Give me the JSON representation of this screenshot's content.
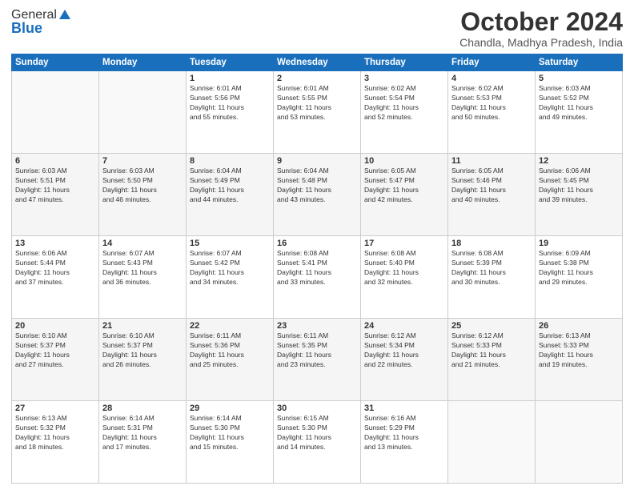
{
  "header": {
    "logo_general": "General",
    "logo_blue": "Blue",
    "title": "October 2024",
    "subtitle": "Chandla, Madhya Pradesh, India"
  },
  "weekdays": [
    "Sunday",
    "Monday",
    "Tuesday",
    "Wednesday",
    "Thursday",
    "Friday",
    "Saturday"
  ],
  "weeks": [
    [
      {
        "day": "",
        "info": ""
      },
      {
        "day": "",
        "info": ""
      },
      {
        "day": "1",
        "info": "Sunrise: 6:01 AM\nSunset: 5:56 PM\nDaylight: 11 hours\nand 55 minutes."
      },
      {
        "day": "2",
        "info": "Sunrise: 6:01 AM\nSunset: 5:55 PM\nDaylight: 11 hours\nand 53 minutes."
      },
      {
        "day": "3",
        "info": "Sunrise: 6:02 AM\nSunset: 5:54 PM\nDaylight: 11 hours\nand 52 minutes."
      },
      {
        "day": "4",
        "info": "Sunrise: 6:02 AM\nSunset: 5:53 PM\nDaylight: 11 hours\nand 50 minutes."
      },
      {
        "day": "5",
        "info": "Sunrise: 6:03 AM\nSunset: 5:52 PM\nDaylight: 11 hours\nand 49 minutes."
      }
    ],
    [
      {
        "day": "6",
        "info": "Sunrise: 6:03 AM\nSunset: 5:51 PM\nDaylight: 11 hours\nand 47 minutes."
      },
      {
        "day": "7",
        "info": "Sunrise: 6:03 AM\nSunset: 5:50 PM\nDaylight: 11 hours\nand 46 minutes."
      },
      {
        "day": "8",
        "info": "Sunrise: 6:04 AM\nSunset: 5:49 PM\nDaylight: 11 hours\nand 44 minutes."
      },
      {
        "day": "9",
        "info": "Sunrise: 6:04 AM\nSunset: 5:48 PM\nDaylight: 11 hours\nand 43 minutes."
      },
      {
        "day": "10",
        "info": "Sunrise: 6:05 AM\nSunset: 5:47 PM\nDaylight: 11 hours\nand 42 minutes."
      },
      {
        "day": "11",
        "info": "Sunrise: 6:05 AM\nSunset: 5:46 PM\nDaylight: 11 hours\nand 40 minutes."
      },
      {
        "day": "12",
        "info": "Sunrise: 6:06 AM\nSunset: 5:45 PM\nDaylight: 11 hours\nand 39 minutes."
      }
    ],
    [
      {
        "day": "13",
        "info": "Sunrise: 6:06 AM\nSunset: 5:44 PM\nDaylight: 11 hours\nand 37 minutes."
      },
      {
        "day": "14",
        "info": "Sunrise: 6:07 AM\nSunset: 5:43 PM\nDaylight: 11 hours\nand 36 minutes."
      },
      {
        "day": "15",
        "info": "Sunrise: 6:07 AM\nSunset: 5:42 PM\nDaylight: 11 hours\nand 34 minutes."
      },
      {
        "day": "16",
        "info": "Sunrise: 6:08 AM\nSunset: 5:41 PM\nDaylight: 11 hours\nand 33 minutes."
      },
      {
        "day": "17",
        "info": "Sunrise: 6:08 AM\nSunset: 5:40 PM\nDaylight: 11 hours\nand 32 minutes."
      },
      {
        "day": "18",
        "info": "Sunrise: 6:08 AM\nSunset: 5:39 PM\nDaylight: 11 hours\nand 30 minutes."
      },
      {
        "day": "19",
        "info": "Sunrise: 6:09 AM\nSunset: 5:38 PM\nDaylight: 11 hours\nand 29 minutes."
      }
    ],
    [
      {
        "day": "20",
        "info": "Sunrise: 6:10 AM\nSunset: 5:37 PM\nDaylight: 11 hours\nand 27 minutes."
      },
      {
        "day": "21",
        "info": "Sunrise: 6:10 AM\nSunset: 5:37 PM\nDaylight: 11 hours\nand 26 minutes."
      },
      {
        "day": "22",
        "info": "Sunrise: 6:11 AM\nSunset: 5:36 PM\nDaylight: 11 hours\nand 25 minutes."
      },
      {
        "day": "23",
        "info": "Sunrise: 6:11 AM\nSunset: 5:35 PM\nDaylight: 11 hours\nand 23 minutes."
      },
      {
        "day": "24",
        "info": "Sunrise: 6:12 AM\nSunset: 5:34 PM\nDaylight: 11 hours\nand 22 minutes."
      },
      {
        "day": "25",
        "info": "Sunrise: 6:12 AM\nSunset: 5:33 PM\nDaylight: 11 hours\nand 21 minutes."
      },
      {
        "day": "26",
        "info": "Sunrise: 6:13 AM\nSunset: 5:33 PM\nDaylight: 11 hours\nand 19 minutes."
      }
    ],
    [
      {
        "day": "27",
        "info": "Sunrise: 6:13 AM\nSunset: 5:32 PM\nDaylight: 11 hours\nand 18 minutes."
      },
      {
        "day": "28",
        "info": "Sunrise: 6:14 AM\nSunset: 5:31 PM\nDaylight: 11 hours\nand 17 minutes."
      },
      {
        "day": "29",
        "info": "Sunrise: 6:14 AM\nSunset: 5:30 PM\nDaylight: 11 hours\nand 15 minutes."
      },
      {
        "day": "30",
        "info": "Sunrise: 6:15 AM\nSunset: 5:30 PM\nDaylight: 11 hours\nand 14 minutes."
      },
      {
        "day": "31",
        "info": "Sunrise: 6:16 AM\nSunset: 5:29 PM\nDaylight: 11 hours\nand 13 minutes."
      },
      {
        "day": "",
        "info": ""
      },
      {
        "day": "",
        "info": ""
      }
    ]
  ]
}
